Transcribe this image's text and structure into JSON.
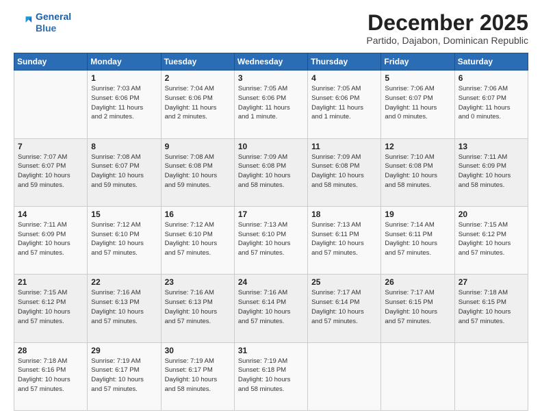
{
  "header": {
    "logo_line1": "General",
    "logo_line2": "Blue",
    "month_title": "December 2025",
    "subtitle": "Partido, Dajabon, Dominican Republic"
  },
  "weekdays": [
    "Sunday",
    "Monday",
    "Tuesday",
    "Wednesday",
    "Thursday",
    "Friday",
    "Saturday"
  ],
  "weeks": [
    [
      {
        "day": "",
        "info": ""
      },
      {
        "day": "1",
        "info": "Sunrise: 7:03 AM\nSunset: 6:06 PM\nDaylight: 11 hours\nand 2 minutes."
      },
      {
        "day": "2",
        "info": "Sunrise: 7:04 AM\nSunset: 6:06 PM\nDaylight: 11 hours\nand 2 minutes."
      },
      {
        "day": "3",
        "info": "Sunrise: 7:05 AM\nSunset: 6:06 PM\nDaylight: 11 hours\nand 1 minute."
      },
      {
        "day": "4",
        "info": "Sunrise: 7:05 AM\nSunset: 6:06 PM\nDaylight: 11 hours\nand 1 minute."
      },
      {
        "day": "5",
        "info": "Sunrise: 7:06 AM\nSunset: 6:07 PM\nDaylight: 11 hours\nand 0 minutes."
      },
      {
        "day": "6",
        "info": "Sunrise: 7:06 AM\nSunset: 6:07 PM\nDaylight: 11 hours\nand 0 minutes."
      }
    ],
    [
      {
        "day": "7",
        "info": "Sunrise: 7:07 AM\nSunset: 6:07 PM\nDaylight: 10 hours\nand 59 minutes."
      },
      {
        "day": "8",
        "info": "Sunrise: 7:08 AM\nSunset: 6:07 PM\nDaylight: 10 hours\nand 59 minutes."
      },
      {
        "day": "9",
        "info": "Sunrise: 7:08 AM\nSunset: 6:08 PM\nDaylight: 10 hours\nand 59 minutes."
      },
      {
        "day": "10",
        "info": "Sunrise: 7:09 AM\nSunset: 6:08 PM\nDaylight: 10 hours\nand 58 minutes."
      },
      {
        "day": "11",
        "info": "Sunrise: 7:09 AM\nSunset: 6:08 PM\nDaylight: 10 hours\nand 58 minutes."
      },
      {
        "day": "12",
        "info": "Sunrise: 7:10 AM\nSunset: 6:08 PM\nDaylight: 10 hours\nand 58 minutes."
      },
      {
        "day": "13",
        "info": "Sunrise: 7:11 AM\nSunset: 6:09 PM\nDaylight: 10 hours\nand 58 minutes."
      }
    ],
    [
      {
        "day": "14",
        "info": "Sunrise: 7:11 AM\nSunset: 6:09 PM\nDaylight: 10 hours\nand 57 minutes."
      },
      {
        "day": "15",
        "info": "Sunrise: 7:12 AM\nSunset: 6:10 PM\nDaylight: 10 hours\nand 57 minutes."
      },
      {
        "day": "16",
        "info": "Sunrise: 7:12 AM\nSunset: 6:10 PM\nDaylight: 10 hours\nand 57 minutes."
      },
      {
        "day": "17",
        "info": "Sunrise: 7:13 AM\nSunset: 6:10 PM\nDaylight: 10 hours\nand 57 minutes."
      },
      {
        "day": "18",
        "info": "Sunrise: 7:13 AM\nSunset: 6:11 PM\nDaylight: 10 hours\nand 57 minutes."
      },
      {
        "day": "19",
        "info": "Sunrise: 7:14 AM\nSunset: 6:11 PM\nDaylight: 10 hours\nand 57 minutes."
      },
      {
        "day": "20",
        "info": "Sunrise: 7:15 AM\nSunset: 6:12 PM\nDaylight: 10 hours\nand 57 minutes."
      }
    ],
    [
      {
        "day": "21",
        "info": "Sunrise: 7:15 AM\nSunset: 6:12 PM\nDaylight: 10 hours\nand 57 minutes."
      },
      {
        "day": "22",
        "info": "Sunrise: 7:16 AM\nSunset: 6:13 PM\nDaylight: 10 hours\nand 57 minutes."
      },
      {
        "day": "23",
        "info": "Sunrise: 7:16 AM\nSunset: 6:13 PM\nDaylight: 10 hours\nand 57 minutes."
      },
      {
        "day": "24",
        "info": "Sunrise: 7:16 AM\nSunset: 6:14 PM\nDaylight: 10 hours\nand 57 minutes."
      },
      {
        "day": "25",
        "info": "Sunrise: 7:17 AM\nSunset: 6:14 PM\nDaylight: 10 hours\nand 57 minutes."
      },
      {
        "day": "26",
        "info": "Sunrise: 7:17 AM\nSunset: 6:15 PM\nDaylight: 10 hours\nand 57 minutes."
      },
      {
        "day": "27",
        "info": "Sunrise: 7:18 AM\nSunset: 6:15 PM\nDaylight: 10 hours\nand 57 minutes."
      }
    ],
    [
      {
        "day": "28",
        "info": "Sunrise: 7:18 AM\nSunset: 6:16 PM\nDaylight: 10 hours\nand 57 minutes."
      },
      {
        "day": "29",
        "info": "Sunrise: 7:19 AM\nSunset: 6:17 PM\nDaylight: 10 hours\nand 57 minutes."
      },
      {
        "day": "30",
        "info": "Sunrise: 7:19 AM\nSunset: 6:17 PM\nDaylight: 10 hours\nand 58 minutes."
      },
      {
        "day": "31",
        "info": "Sunrise: 7:19 AM\nSunset: 6:18 PM\nDaylight: 10 hours\nand 58 minutes."
      },
      {
        "day": "",
        "info": ""
      },
      {
        "day": "",
        "info": ""
      },
      {
        "day": "",
        "info": ""
      }
    ]
  ]
}
